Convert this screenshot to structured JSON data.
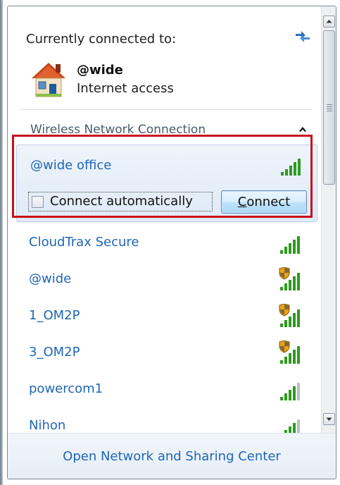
{
  "current": {
    "title": "Currently connected to:",
    "network_name": "@wide",
    "network_status": "Internet access"
  },
  "section": {
    "label": "Wireless Network Connection"
  },
  "selected": {
    "name": "@wide office",
    "autoconnect_label": "Connect automatically",
    "autoconnect_checked": false,
    "connect_button_prefix": "C",
    "connect_button_rest": "onnect"
  },
  "networks": [
    {
      "name": "CloudTrax Secure",
      "secured": false,
      "signal_bars": 5
    },
    {
      "name": "@wide",
      "secured": true,
      "signal_bars": 5
    },
    {
      "name": "1_OM2P",
      "secured": true,
      "signal_bars": 5
    },
    {
      "name": "3_OM2P",
      "secured": true,
      "signal_bars": 5
    },
    {
      "name": "powercom1",
      "secured": false,
      "signal_bars": 4
    },
    {
      "name": "Nihon",
      "secured": false,
      "signal_bars": 4
    }
  ],
  "footer": {
    "link": "Open Network and Sharing Center"
  },
  "colors": {
    "link_blue": "#1f66b4",
    "signal_green": "#2e9a1e",
    "highlight_red": "#c8101b"
  },
  "icons": {
    "refresh": "refresh-icon",
    "house": "house-icon",
    "collapse": "chevron-up-icon",
    "signal": "signal-strength-icon",
    "shield": "security-shield-icon"
  }
}
